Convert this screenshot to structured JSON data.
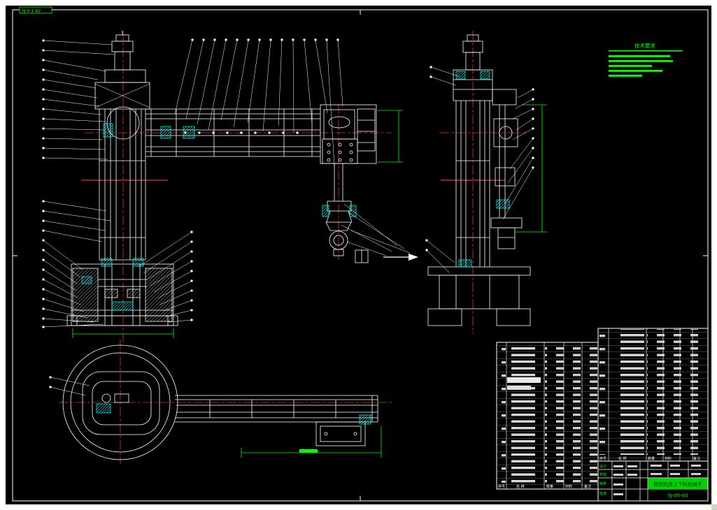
{
  "window": {
    "page_bg": "#ffffff",
    "canvas_bg": "#000000"
  },
  "colors": {
    "line": "#ffffff",
    "dimension_green": "#00ff00",
    "highlight_cyan": "#00ffff",
    "centerline_red": "#e03232",
    "title_cell_green": "#00d200"
  },
  "corner_label": {
    "text": "SJ-0-1-A2"
  },
  "technical_notes": {
    "heading": "技术要求"
  },
  "parts_list": {
    "headers": [
      "序号",
      "名 称",
      "数量",
      "材料",
      "备注"
    ]
  },
  "title_block": {
    "title": "数控机床上下料机械手",
    "drawing_no": "SJ-00-00",
    "row_labels": [
      "设计",
      "校核",
      "审核",
      "批准"
    ]
  }
}
